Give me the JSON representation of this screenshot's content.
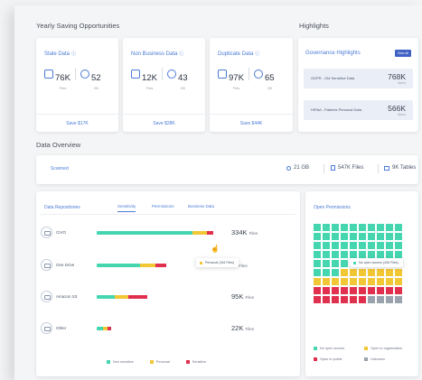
{
  "savings": {
    "title": "Yearly Saving Opportunities",
    "cards": [
      {
        "title": "Stale Data",
        "stat1": "76K",
        "sub1": "Files",
        "stat2": "52",
        "sub2": "GB",
        "footer": "Save $17K"
      },
      {
        "title": "Non Business Data",
        "stat1": "12K",
        "sub1": "Files",
        "stat2": "43",
        "sub2": "GB",
        "footer": "Save $28K"
      },
      {
        "title": "Duplicate Data",
        "stat1": "97K",
        "sub1": "Files",
        "stat2": "65",
        "sub2": "GB",
        "footer": "Save $44K"
      }
    ]
  },
  "highlights": {
    "title": "Highlights",
    "header": "Governance Highlights",
    "view_all": "View All",
    "rows": [
      {
        "label": "GDPR - Old Sensitive Data",
        "value": "768K",
        "unit": "Items"
      },
      {
        "label": "HIPAA - Patients Personal Data",
        "value": "566K",
        "unit": "Items"
      }
    ]
  },
  "overview": {
    "title": "Data Overview",
    "scanned": "Scanned",
    "gb": "21 GB",
    "files": "547K Files",
    "tables": "9K Tables"
  },
  "repositories": {
    "title": "Data Repositories",
    "tabs": [
      "Sensitivity",
      "Permissions",
      "Business Data"
    ],
    "rows": [
      {
        "name": "CIVO",
        "value": "334K",
        "unit": "Files",
        "segments": [
          {
            "color": "#45d6b0",
            "frac": 0.8
          },
          {
            "color": "#f2c735",
            "frac": 0.12
          },
          {
            "color": "#e0304e",
            "frac": 0.05
          }
        ]
      },
      {
        "name": "One Drive",
        "value": "5",
        "unit": "Files",
        "segments": [
          {
            "color": "#45d6b0",
            "frac": 0.36
          },
          {
            "color": "#f2c735",
            "frac": 0.13
          },
          {
            "color": "#e0304e",
            "frac": 0.09
          }
        ]
      },
      {
        "name": "Amazon S3",
        "value": "95K",
        "unit": "Files",
        "segments": [
          {
            "color": "#45d6b0",
            "frac": 0.15
          },
          {
            "color": "#f2c735",
            "frac": 0.11
          },
          {
            "color": "#e0304e",
            "frac": 0.16
          }
        ]
      },
      {
        "name": "Other",
        "value": "22K",
        "unit": "Files",
        "segments": [
          {
            "color": "#45d6b0",
            "frac": 0.05
          },
          {
            "color": "#f2c735",
            "frac": 0.04
          },
          {
            "color": "#e0304e",
            "frac": 0.03
          }
        ]
      }
    ],
    "tooltip": "Personal (184 Files)",
    "legend": [
      {
        "label": "Non sensitive",
        "color": "#45d6b0"
      },
      {
        "label": "Personal",
        "color": "#f2c735"
      },
      {
        "label": "Sensitive",
        "color": "#e0304e"
      }
    ]
  },
  "permissions": {
    "title": "Open Permissions",
    "tooltip": "No open access (436 Files)",
    "rows": [
      [
        "#45d6b0",
        "#45d6b0",
        "#45d6b0",
        "#45d6b0",
        "#45d6b0",
        "#45d6b0",
        "#45d6b0",
        "#45d6b0",
        "#45d6b0",
        "#45d6b0"
      ],
      [
        "#45d6b0",
        "#45d6b0",
        "#45d6b0",
        "#45d6b0",
        "#45d6b0",
        "#45d6b0",
        "#45d6b0",
        "#45d6b0",
        "#45d6b0",
        "#45d6b0"
      ],
      [
        "#45d6b0",
        "#45d6b0",
        "#45d6b0",
        "#45d6b0",
        "#45d6b0",
        "#45d6b0",
        "#45d6b0",
        "#45d6b0",
        "#45d6b0",
        "#45d6b0"
      ],
      [
        "#45d6b0",
        "#45d6b0",
        "#45d6b0",
        "#45d6b0",
        "#45d6b0",
        "#45d6b0",
        "#45d6b0",
        "#45d6b0",
        "#45d6b0",
        "#45d6b0"
      ],
      [
        "#45d6b0",
        "#45d6b0",
        "#45d6b0",
        "#45d6b0",
        "#45d6b0",
        "#45d6b0",
        "#45d6b0",
        "#45d6b0",
        "#45d6b0",
        "#45d6b0"
      ],
      [
        "#45d6b0",
        "#45d6b0",
        "#45d6b0",
        "#f2c735",
        "#f2c735",
        "#f2c735",
        "#f2c735",
        "#f2c735",
        "#f2c735",
        "#f2c735"
      ],
      [
        "#f2c735",
        "#f2c735",
        "#f2c735",
        "#f2c735",
        "#f2c735",
        "#f2c735",
        "#f2c735",
        "#f2c735",
        "#f2c735",
        "#f2c735"
      ],
      [
        "#e0304e",
        "#e0304e",
        "#e0304e",
        "#e0304e",
        "#e0304e",
        "#e0304e",
        "#e0304e",
        "#e0304e",
        "#e0304e",
        "#e0304e"
      ],
      [
        "#e0304e",
        "#e0304e",
        "#e0304e",
        "#e0304e",
        "#e0304e",
        "#e0304e",
        "#9aa3ad",
        "#9aa3ad",
        "#9aa3ad",
        "#9aa3ad"
      ]
    ],
    "legend": [
      {
        "label": "No open access",
        "color": "#45d6b0"
      },
      {
        "label": "Open to organization",
        "color": "#f2c735"
      },
      {
        "label": "Open to public",
        "color": "#e0304e"
      },
      {
        "label": "Unknown",
        "color": "#9aa3ad"
      }
    ]
  }
}
